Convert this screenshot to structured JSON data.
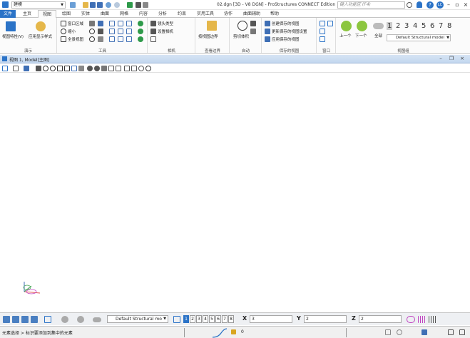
{
  "titlebar": {
    "workspace": "建模",
    "doc_title": "02.dgn [3D - V8 DGN] - ProStructures CONNECT Edition",
    "search_placeholder": "键入功能区 (F4)",
    "user_initials": "LC"
  },
  "tabs": [
    "文件",
    "主页",
    "视图",
    "绘图",
    "实体",
    "曲面",
    "网格",
    "内容",
    "分析",
    "约束",
    "实用工具",
    "协作",
    "曲面辅助",
    "帮助"
  ],
  "ribbon": {
    "demo": {
      "label": "演示",
      "items": [
        "视图特性(V)",
        "应用显示样式"
      ]
    },
    "tools": {
      "label": "工具",
      "items": [
        "窗口区域",
        "缩小",
        "全景视图"
      ]
    },
    "camera": {
      "label": "相机",
      "items": [
        "镜头类型",
        "设置相机"
      ]
    },
    "clip": {
      "label": "查看边界",
      "items": [
        "按视图边界"
      ]
    },
    "autoclip": {
      "label": "自动",
      "items": [
        "剪切体积"
      ]
    },
    "saved": {
      "label": "保存的视图",
      "items": [
        "创建保存的视图",
        "更新保存的视图设置",
        "应用保存的视图"
      ]
    },
    "window": {
      "label": "窗口"
    },
    "viewgroup": {
      "label": "视图组",
      "prev": "上一个",
      "next": "下一个",
      "all": "全部",
      "numbers": [
        "1",
        "2",
        "3",
        "4",
        "5",
        "6",
        "7",
        "8"
      ],
      "model": "Default Structural model"
    }
  },
  "view": {
    "title": "视图 1, Model[主图]"
  },
  "bottombar": {
    "model": "Default Structural mo",
    "view_numbers": [
      "1",
      "2",
      "3",
      "4",
      "5",
      "6",
      "7",
      "8"
    ],
    "x_label": "X",
    "x_value": "3",
    "y_label": "Y",
    "y_value": "2",
    "z_label": "Z",
    "z_value": "2"
  },
  "status": {
    "text": "元素选择 > 标识要添加到集中的元素",
    "count": "0"
  },
  "colors": {
    "accent": "#2b73c7",
    "viewtitle": "#c3d7ef"
  }
}
